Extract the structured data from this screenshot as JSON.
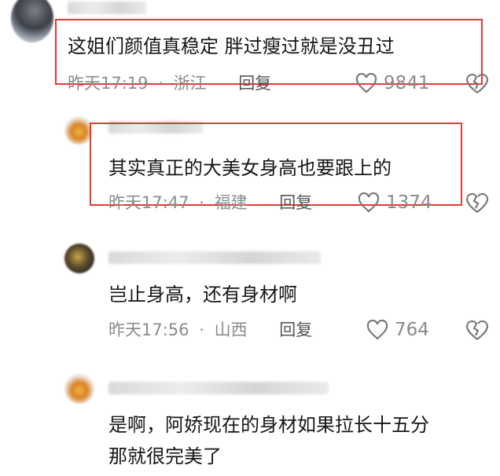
{
  "comments": [
    {
      "username": "",
      "text": "这姐们颜值真稳定  胖过瘦过就是没丑过",
      "time": "昨天17:19",
      "location": "浙江",
      "reply_label": "回复",
      "likes": "9841",
      "highlighted": true
    },
    {
      "username": "",
      "text": "其实真正的大美女身高也要跟上的",
      "time": "昨天17:47",
      "location": "福建",
      "reply_label": "回复",
      "likes": "1374",
      "highlighted": true
    },
    {
      "username": "",
      "text": "岂止身高，还有身材啊",
      "time": "昨天17:56",
      "location": "山西",
      "reply_label": "回复",
      "likes": "764",
      "highlighted": false
    },
    {
      "username": "",
      "text_line1": "是啊，阿娇现在的身材如果拉长十五分",
      "text_line2": "那就很完美了",
      "highlighted": false
    }
  ],
  "icons": {
    "like": "heart-outline-icon",
    "dislike": "broken-heart-icon"
  },
  "colors": {
    "highlight_border": "#e53935",
    "meta_text": "#8b8b8b",
    "body_text": "#161616"
  },
  "separator": "·"
}
